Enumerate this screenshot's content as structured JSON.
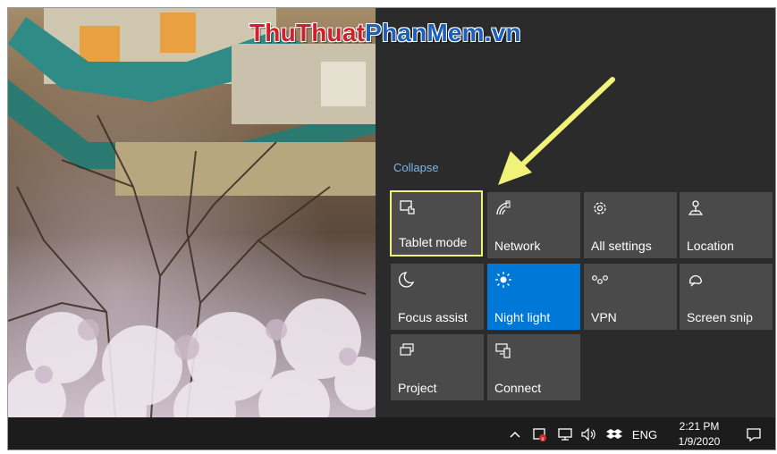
{
  "watermark": {
    "part1": "ThuThuat",
    "part2": "PhanMem",
    "part3": ".vn"
  },
  "action_center": {
    "collapse_label": "Collapse",
    "tiles": [
      {
        "label": "Tablet mode",
        "icon": "tablet-mode-icon",
        "state": "off",
        "highlighted": true
      },
      {
        "label": "Network",
        "icon": "network-icon",
        "state": "off"
      },
      {
        "label": "All settings",
        "icon": "gear-icon",
        "state": "off"
      },
      {
        "label": "Location",
        "icon": "location-icon",
        "state": "off"
      },
      {
        "label": "Focus assist",
        "icon": "moon-icon",
        "state": "off"
      },
      {
        "label": "Night light",
        "icon": "sun-icon",
        "state": "on"
      },
      {
        "label": "VPN",
        "icon": "vpn-icon",
        "state": "off"
      },
      {
        "label": "Screen snip",
        "icon": "screen-snip-icon",
        "state": "off"
      },
      {
        "label": "Project",
        "icon": "project-icon",
        "state": "off"
      },
      {
        "label": "Connect",
        "icon": "connect-icon",
        "state": "off"
      }
    ]
  },
  "taskbar": {
    "tray_icons": [
      "chevron-up-icon",
      "security-alert-icon",
      "network-monitor-icon",
      "volume-icon",
      "dropbox-icon"
    ],
    "language": "ENG",
    "time": "2:21 PM",
    "date": "1/9/2020",
    "notification_icon": "action-center-icon"
  },
  "colors": {
    "panel_bg": "#2b2b2b",
    "tile_bg": "#4a4a4a",
    "tile_on": "#0078d7",
    "collapse_link": "#7bb7ef",
    "highlight_annotation": "#f1f27a",
    "taskbar_bg": "#1c1c1c"
  }
}
